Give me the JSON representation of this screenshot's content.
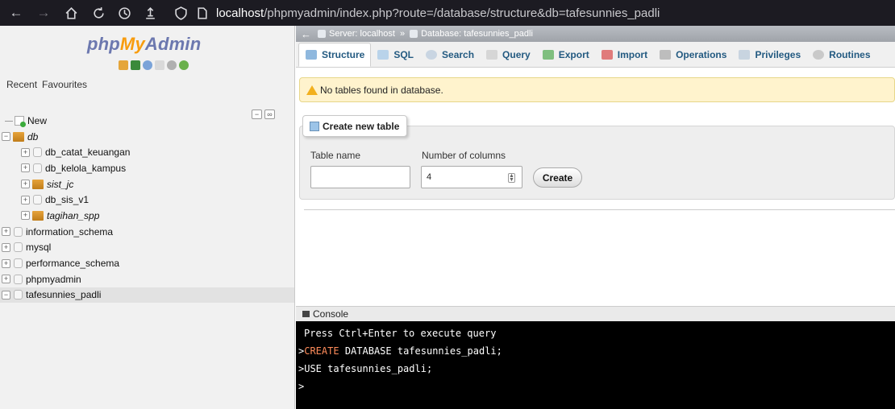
{
  "browser": {
    "url_host": "localhost",
    "url_path": "/phpmyadmin/index.php?route=/database/structure&db=tafesunnies_padli"
  },
  "sidebar": {
    "logo": {
      "php": "php",
      "my": "My",
      "admin": "Admin"
    },
    "recent_label": "Recent",
    "favourites_label": "Favourites",
    "tree": {
      "new_label": "New",
      "db_group": "db",
      "db_children": [
        "db_catat_keuangan",
        "db_kelola_kampus",
        "sist_jc",
        "db_sis_v1",
        "tagihan_spp"
      ],
      "databases": [
        "information_schema",
        "mysql",
        "performance_schema",
        "phpmyadmin",
        "tafesunnies_padli"
      ]
    }
  },
  "breadcrumb": {
    "server": "Server: localhost",
    "sep": "»",
    "database": "Database: tafesunnies_padli"
  },
  "tabs": [
    "Structure",
    "SQL",
    "Search",
    "Query",
    "Export",
    "Import",
    "Operations",
    "Privileges",
    "Routines"
  ],
  "notice": "No tables found in database.",
  "create_table": {
    "legend": "Create new table",
    "table_name_label": "Table name",
    "table_name_value": "",
    "columns_label": "Number of columns",
    "columns_value": "4",
    "create_button": "Create"
  },
  "console": {
    "title": "Console",
    "hint": "Press Ctrl+Enter to execute query",
    "prompt": ">",
    "line1_kw": "CREATE",
    "line1_rest": " DATABASE tafesunnies_padli;",
    "line2": "USE tafesunnies_padli;"
  }
}
